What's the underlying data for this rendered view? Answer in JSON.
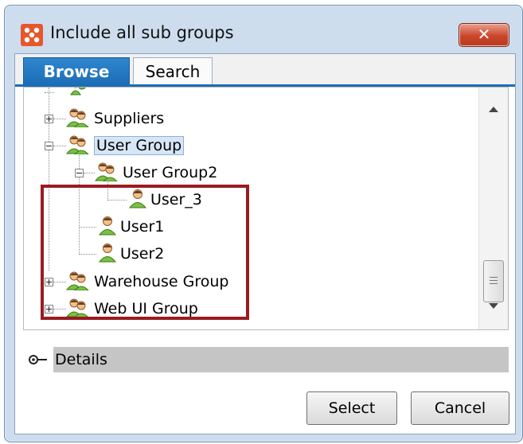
{
  "window": {
    "title": "Include all sub groups",
    "close_glyph": "✕"
  },
  "tabs": [
    {
      "label": "Browse",
      "active": true
    },
    {
      "label": "Search",
      "active": false
    }
  ],
  "tree": [
    {
      "label": "Suppliers",
      "type": "group",
      "state": "collapsed"
    },
    {
      "label": "User Group",
      "type": "group",
      "state": "expanded",
      "selected": true
    },
    {
      "label": "User Group2",
      "type": "group",
      "state": "expanded"
    },
    {
      "label": "User_3",
      "type": "user"
    },
    {
      "label": "User1",
      "type": "user"
    },
    {
      "label": "User2",
      "type": "user"
    },
    {
      "label": "Warehouse Group",
      "type": "group",
      "state": "collapsed"
    },
    {
      "label": "Web UI Group",
      "type": "group",
      "state": "collapsed"
    }
  ],
  "details": {
    "label": "Details"
  },
  "buttons": {
    "select": "Select",
    "cancel": "Cancel"
  },
  "colors": {
    "accent": "#1c6db5",
    "highlight_border": "#9a1b22",
    "close_button": "#c9462a",
    "selection_bg": "#d7e6f6"
  },
  "icons": {
    "app": "app-logo-icon",
    "group": "user-group-icon",
    "user": "user-icon",
    "details": "details-toggle-icon"
  }
}
